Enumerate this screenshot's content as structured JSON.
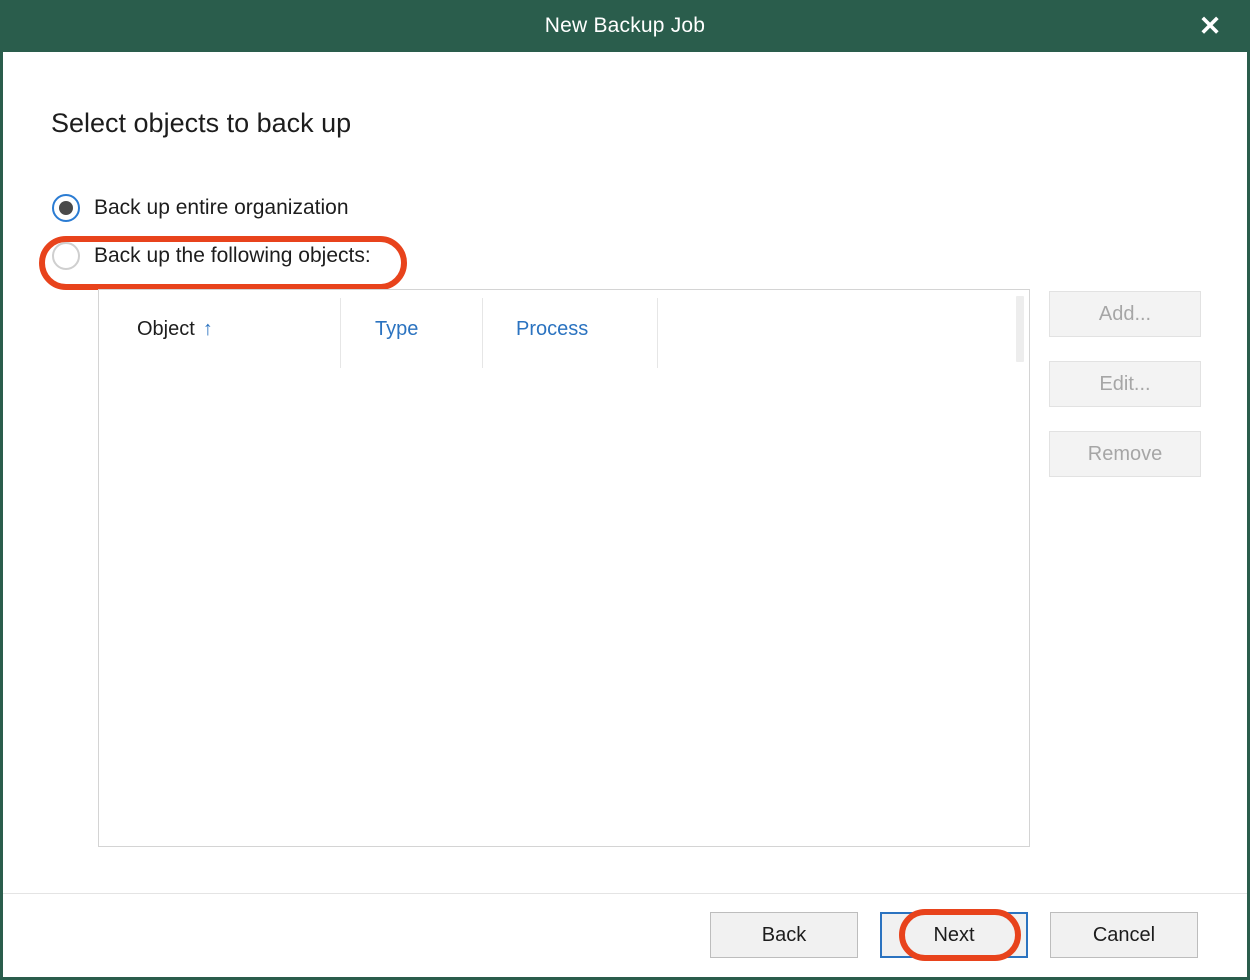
{
  "window": {
    "title": "New Backup Job",
    "close_icon": "close-icon",
    "titlebar_color": "#2a5d4c"
  },
  "page": {
    "heading": "Select objects to back up"
  },
  "scope_options": [
    {
      "label": "Back up entire organization",
      "selected": true
    },
    {
      "label": "Back up the following objects:",
      "selected": false
    }
  ],
  "objects_table": {
    "columns": [
      {
        "label": "Object",
        "sorted": true,
        "sort_icon": "sort-ascending-arrow-icon",
        "sort_glyph": "↑",
        "style": "dark"
      },
      {
        "label": "Type",
        "sorted": false,
        "style": "link"
      },
      {
        "label": "Process",
        "sorted": false,
        "style": "link"
      },
      {
        "label": "",
        "sorted": false,
        "style": "blank"
      }
    ],
    "rows": [],
    "empty": true
  },
  "side_buttons": [
    {
      "label": "Add...",
      "enabled": false
    },
    {
      "label": "Edit...",
      "enabled": false
    },
    {
      "label": "Remove",
      "enabled": false
    }
  ],
  "footer_buttons": [
    {
      "label": "Back",
      "focused": false,
      "highlighted": false
    },
    {
      "label": "Next",
      "focused": true,
      "highlighted": true
    },
    {
      "label": "Cancel",
      "focused": false,
      "highlighted": false
    }
  ],
  "annotations": {
    "color": "#e8431c",
    "targets": [
      "Back up entire organization",
      "Next"
    ]
  },
  "colors": {
    "title_bar": "#2a5d4c",
    "link_blue": "#2b73c0",
    "focus_blue": "#2b73c0",
    "annotation_red": "#e8431c",
    "disabled_text": "#a6a6a6"
  }
}
